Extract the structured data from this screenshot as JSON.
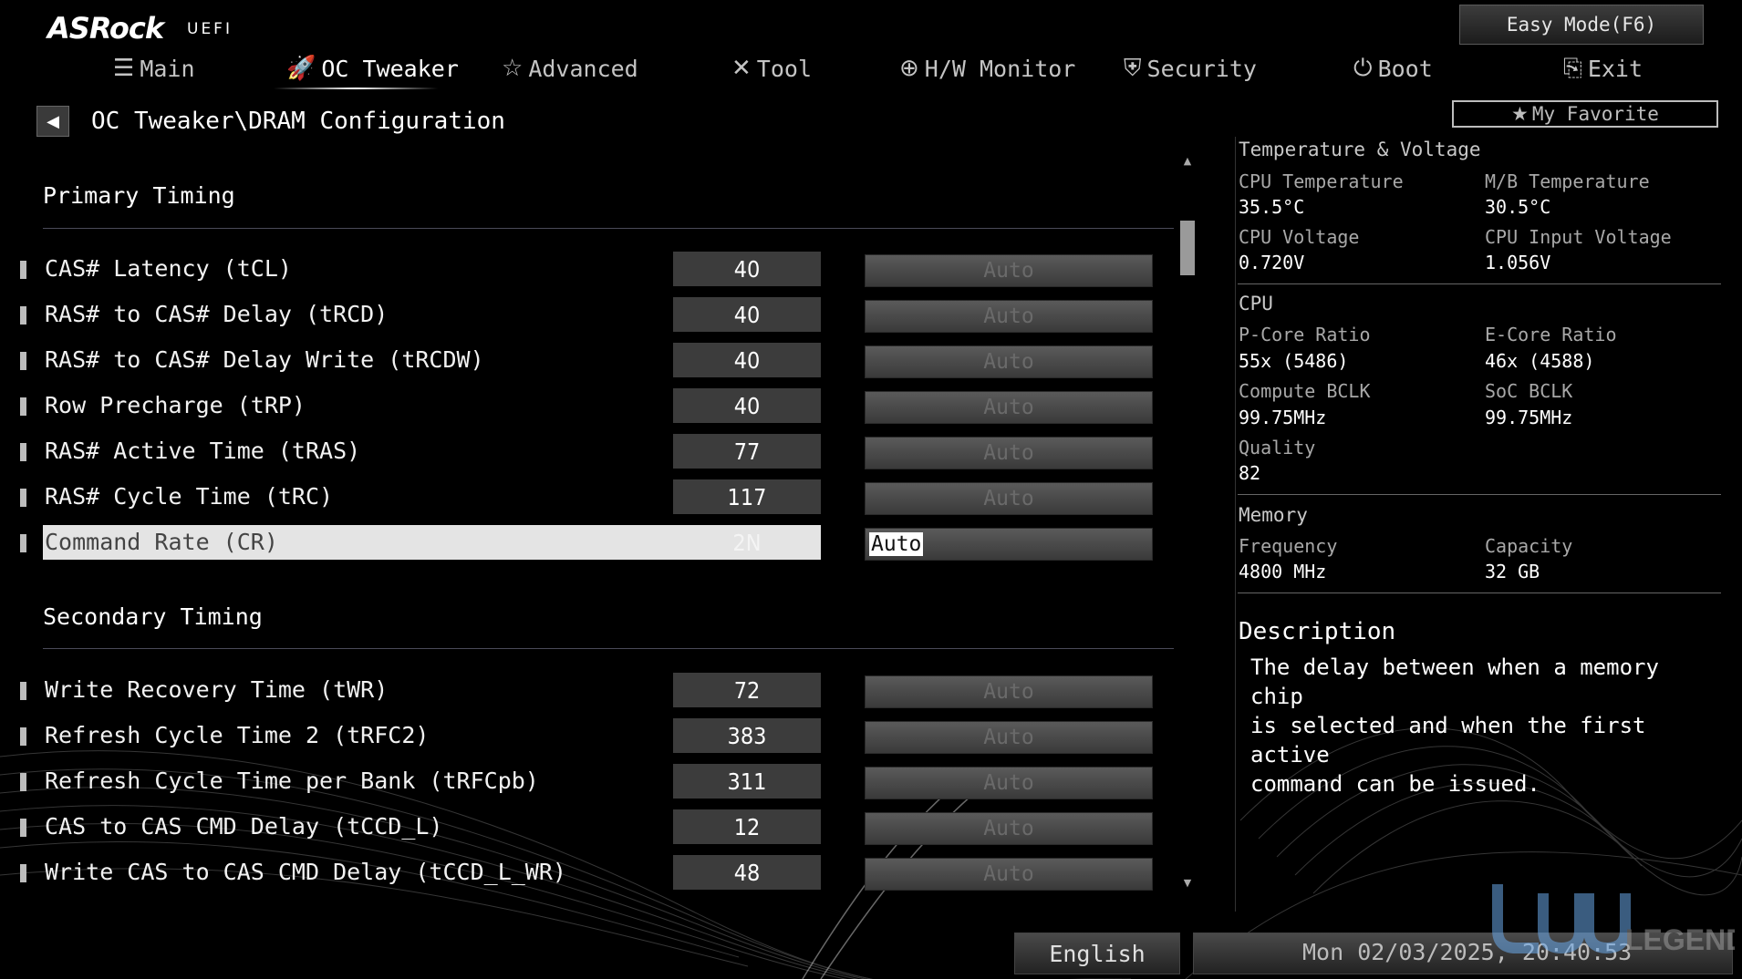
{
  "header": {
    "brand": "ASRock",
    "brand_sub": "UEFI",
    "easy_mode_label": "Easy Mode(F6)",
    "tabs": [
      {
        "label": "Main",
        "icon": "list-icon"
      },
      {
        "label": "OC Tweaker",
        "icon": "rocket-icon",
        "active": true
      },
      {
        "label": "Advanced",
        "icon": "star-outline-icon"
      },
      {
        "label": "Tool",
        "icon": "tools-icon"
      },
      {
        "label": "H/W Monitor",
        "icon": "crosshair-icon"
      },
      {
        "label": "Security",
        "icon": "shield-icon"
      },
      {
        "label": "Boot",
        "icon": "power-icon"
      },
      {
        "label": "Exit",
        "icon": "exit-door-icon"
      }
    ]
  },
  "breadcrumb": "OC Tweaker\\DRAM Configuration",
  "favorite_label": "My Favorite",
  "primary_timing": {
    "title": "Primary Timing",
    "rows": [
      {
        "label": "CAS# Latency (tCL)",
        "value": "40",
        "option": "Auto"
      },
      {
        "label": "RAS# to CAS# Delay (tRCD)",
        "value": "40",
        "option": "Auto"
      },
      {
        "label": "RAS# to CAS# Delay Write (tRCDW)",
        "value": "40",
        "option": "Auto"
      },
      {
        "label": "Row Precharge (tRP)",
        "value": "40",
        "option": "Auto"
      },
      {
        "label": "RAS# Active Time (tRAS)",
        "value": "77",
        "option": "Auto"
      },
      {
        "label": "RAS# Cycle Time (tRC)",
        "value": "117",
        "option": "Auto"
      },
      {
        "label": "Command Rate (CR)",
        "value": "2N",
        "option": "Auto",
        "selected": true
      }
    ]
  },
  "secondary_timing": {
    "title": "Secondary Timing",
    "rows": [
      {
        "label": "Write Recovery Time (tWR)",
        "value": "72",
        "option": "Auto"
      },
      {
        "label": "Refresh Cycle Time 2 (tRFC2)",
        "value": "383",
        "option": "Auto"
      },
      {
        "label": "Refresh Cycle Time per Bank (tRFCpb)",
        "value": "311",
        "option": "Auto"
      },
      {
        "label": "CAS to CAS CMD Delay (tCCD_L)",
        "value": "12",
        "option": "Auto"
      },
      {
        "label": "Write CAS to CAS CMD Delay (tCCD_L_WR)",
        "value": "48",
        "option": "Auto"
      }
    ]
  },
  "monitor": {
    "temp_volt_title": "Temperature & Voltage",
    "cpu_temp_label": "CPU Temperature",
    "cpu_temp": "35.5°C",
    "mb_temp_label": "M/B Temperature",
    "mb_temp": "30.5°C",
    "cpu_volt_label": "CPU Voltage",
    "cpu_volt": "0.720V",
    "cpu_input_volt_label": "CPU Input Voltage",
    "cpu_input_volt": "1.056V",
    "cpu_title": "CPU",
    "pcore_label": "P-Core Ratio",
    "pcore": "55x (5486)",
    "ecore_label": "E-Core Ratio",
    "ecore": "46x (4588)",
    "compute_bclk_label": "Compute BCLK",
    "compute_bclk": "99.75MHz",
    "soc_bclk_label": "SoC BCLK",
    "soc_bclk": "99.75MHz",
    "quality_label": "Quality",
    "quality": "82",
    "memory_title": "Memory",
    "freq_label": "Frequency",
    "freq": "4800 MHz",
    "capacity_label": "Capacity",
    "capacity": "32 GB"
  },
  "description": {
    "title": "Description",
    "text": "The delay between when a memory chip\nis selected and when the first active\ncommand can be issued."
  },
  "footer": {
    "language": "English",
    "datetime": "Mon 02/03/2025, 20:40:53",
    "watermark": "LEGEND"
  }
}
